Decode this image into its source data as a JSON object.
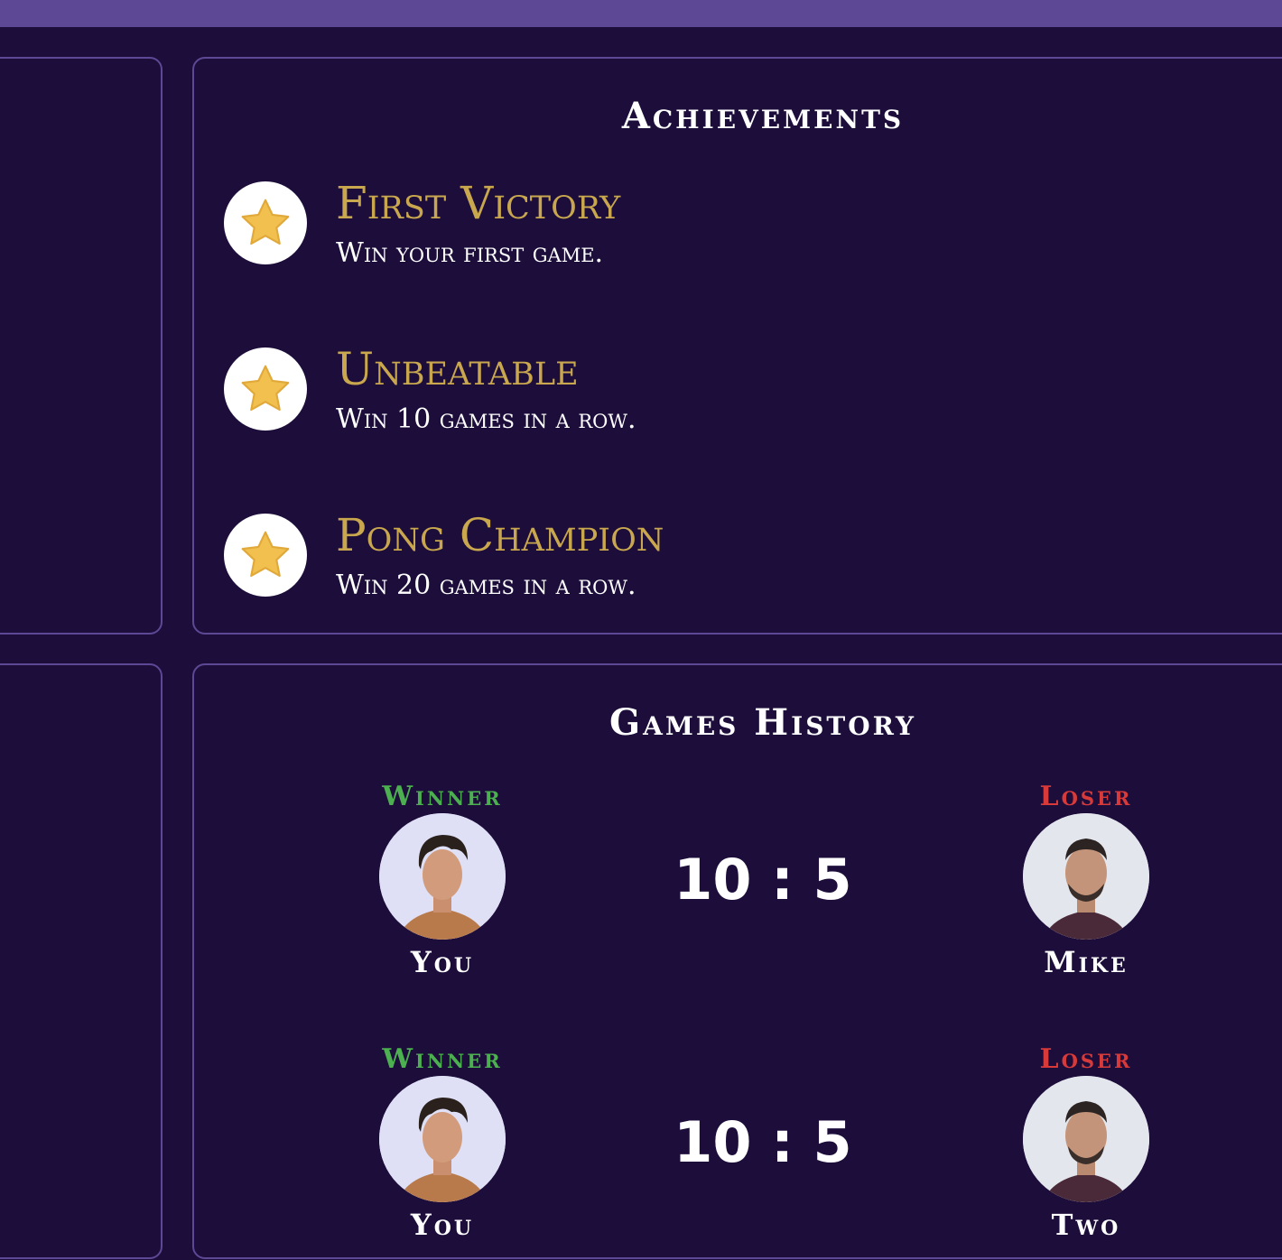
{
  "achievements": {
    "title": "Achievements",
    "items": [
      {
        "name": "First Victory",
        "description": "Win your first game.",
        "icon": "star-icon"
      },
      {
        "name": "Unbeatable",
        "description": "Win 10 games in a row.",
        "icon": "star-icon"
      },
      {
        "name": "Pong Champion",
        "description": "Win 20 games in a row.",
        "icon": "star-icon"
      }
    ]
  },
  "history": {
    "title": "Games History",
    "games": [
      {
        "winner_label": "Winner",
        "winner_name": "You",
        "score": "10 : 5",
        "loser_label": "Loser",
        "loser_name": "Mike"
      },
      {
        "winner_label": "Winner",
        "winner_name": "You",
        "score": "10 : 5",
        "loser_label": "Loser",
        "loser_name": "Two"
      }
    ]
  },
  "colors": {
    "background": "#1c0d3a",
    "border": "#5c4894",
    "gold": "#c9a74e",
    "winner": "#4caf50",
    "loser": "#d83a3a"
  }
}
